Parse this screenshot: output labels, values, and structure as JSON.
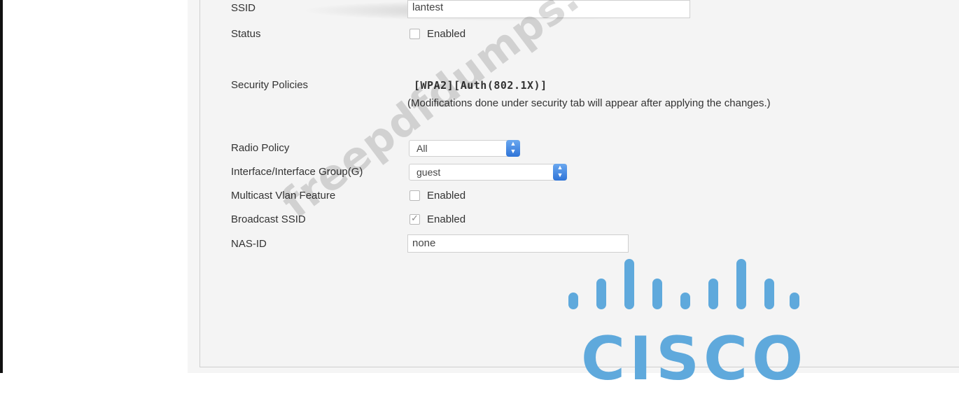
{
  "form": {
    "ssid": {
      "label": "SSID",
      "value": "lantest"
    },
    "status": {
      "label": "Status",
      "checkbox_label": "Enabled",
      "checked": false
    },
    "security_policies": {
      "label": "Security Policies",
      "value": "[WPA2][Auth(802.1X)]",
      "note": "(Modifications done under security tab will appear after applying the changes.)"
    },
    "radio_policy": {
      "label": "Radio Policy",
      "selected": "All"
    },
    "interface_group": {
      "label": "Interface/Interface Group(G)",
      "selected": "guest"
    },
    "multicast_vlan": {
      "label": "Multicast Vlan Feature",
      "checkbox_label": "Enabled",
      "checked": false
    },
    "broadcast_ssid": {
      "label": "Broadcast SSID",
      "checkbox_label": "Enabled",
      "checked": true
    },
    "nas_id": {
      "label": "NAS-ID",
      "value": "none"
    }
  },
  "watermark": {
    "text": "freepdfdumps.com"
  },
  "logo": {
    "text": "CISCO",
    "color": "#5fa9dc"
  }
}
